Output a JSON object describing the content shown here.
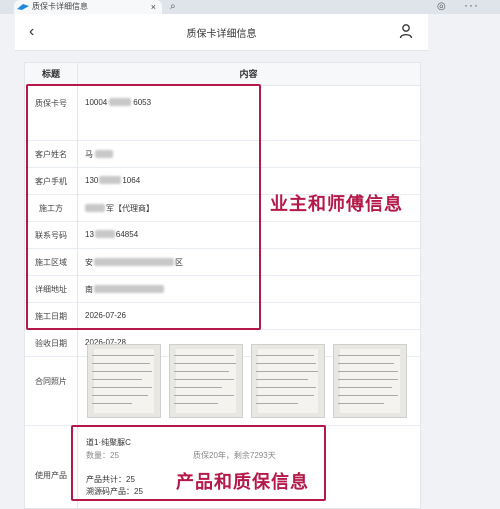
{
  "browser": {
    "tab_title": "质保卡详细信息",
    "tab_close": "×",
    "icons": [
      "browser-favicon",
      "search-icon",
      "globe-icon",
      "more-icon"
    ]
  },
  "header": {
    "back": "‹",
    "title": "质保卡详细信息"
  },
  "table": {
    "col_title": "标题",
    "col_content": "内容",
    "rows": [
      {
        "label": "质保卡号",
        "value_pre": "10004",
        "value_post": "6053"
      },
      {
        "label": "客户姓名",
        "value_pre": "马",
        "value_post": ""
      },
      {
        "label": "客户手机",
        "value_pre": "130",
        "value_post": "1064"
      },
      {
        "label": "施工方",
        "value_pre": "",
        "value_post": "军【代理商】"
      },
      {
        "label": "联系号码",
        "value_pre": "13",
        "value_post": "64854"
      },
      {
        "label": "施工区域",
        "value_pre": "安",
        "value_post": "区"
      },
      {
        "label": "详细地址",
        "value_pre": "南",
        "value_post": ""
      },
      {
        "label": "施工日期",
        "value_pre": "2026-07-26",
        "value_post": ""
      },
      {
        "label": "验收日期",
        "value_pre": "2026-07-28",
        "value_post": ""
      }
    ],
    "photos_label": "合同照片",
    "product_label": "使用产品"
  },
  "product": {
    "name": "道1·纯聚脲C",
    "qty": "数量：25",
    "warranty": "质保20年，剩余7293天",
    "total": "产品共计：25",
    "trace": "溯源码产品：25"
  },
  "annotations": {
    "owner_master": "业主和师傅信息",
    "product_warranty": "产品和质保信息",
    "color": "#b5194a"
  }
}
